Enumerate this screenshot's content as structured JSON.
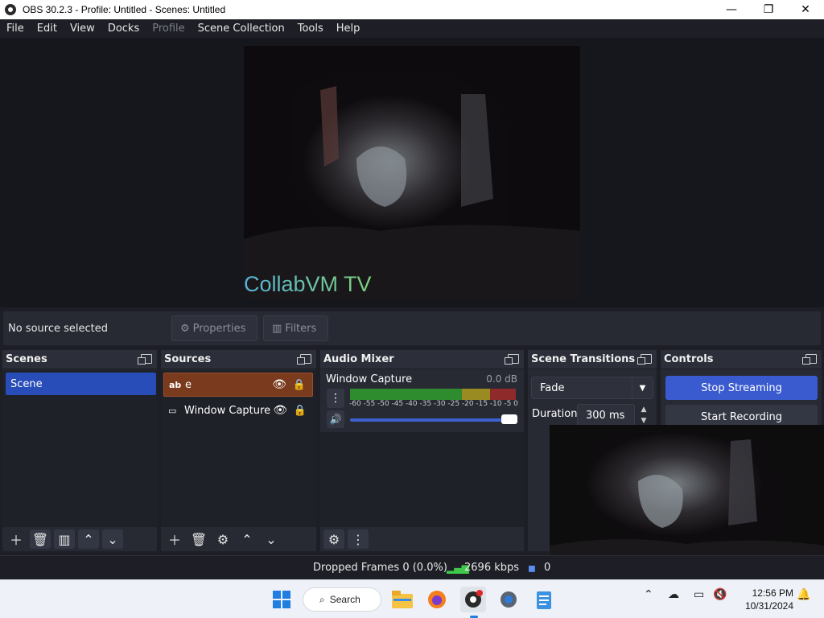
{
  "window": {
    "title": "OBS 30.2.3 - Profile: Untitled - Scenes: Untitled",
    "minimize": "—",
    "maximize": "❐",
    "close": "✕"
  },
  "menu": [
    "File",
    "Edit",
    "View",
    "Docks",
    "Profile",
    "Scene Collection",
    "Tools",
    "Help"
  ],
  "preview": {
    "overlay_text": "CollabVM TV"
  },
  "source_toolbar": {
    "status": "No source selected",
    "properties_label": "Properties",
    "filters_label": "Filters"
  },
  "scenes": {
    "title": "Scenes",
    "items": [
      "Scene"
    ]
  },
  "sources": {
    "title": "Sources",
    "items": [
      {
        "icon": "ab",
        "label": "e",
        "selected": true
      },
      {
        "icon": "window",
        "label": "Window Capture",
        "selected": false
      }
    ]
  },
  "audio_mixer": {
    "title": "Audio Mixer",
    "channel": "Window Capture",
    "level": "0.0 dB",
    "scale": [
      "-60",
      "-55",
      "-50",
      "-45",
      "-40",
      "-35",
      "-30",
      "-25",
      "-20",
      "-15",
      "-10",
      "-5",
      "0"
    ],
    "volume": 1.0
  },
  "transitions": {
    "title": "Scene Transitions",
    "selected": "Fade",
    "duration_label": "Duration",
    "duration_value": "300 ms"
  },
  "controls": {
    "title": "Controls",
    "stop_streaming": "Stop Streaming",
    "start_recording": "Start Recording"
  },
  "status": {
    "dropped_frames": "Dropped Frames 0 (0.0%)",
    "bitrate": "2696 kbps",
    "extra": "0"
  },
  "taskbar": {
    "search_label": "Search",
    "time": "12:56 PM",
    "date": "10/31/2024"
  },
  "colors": {
    "accent_blue": "#284cb8",
    "selected_source": "#7a3a1e",
    "meter_green": "#2e8b2e",
    "meter_yellow": "#9a8a22",
    "meter_red": "#8f2a2a"
  }
}
